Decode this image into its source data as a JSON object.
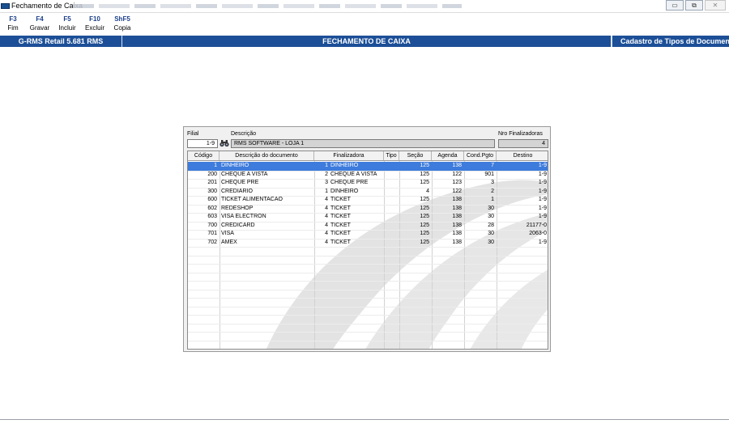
{
  "window": {
    "title": "Fechamento de Caixa",
    "controls": {
      "minimize": "▭",
      "restore": "⧉",
      "close": "✕"
    }
  },
  "toolbar": {
    "keys": [
      {
        "key": "F3",
        "label": "Fim"
      },
      {
        "key": "F4",
        "label": "Gravar"
      },
      {
        "key": "F5",
        "label": "Incluir"
      },
      {
        "key": "F10",
        "label": "Excluir"
      },
      {
        "key": "ShF5",
        "label": "Copia"
      }
    ]
  },
  "header": {
    "app_version": "G-RMS Retail 5.681 RMS",
    "screen_title": "FECHAMENTO DE CAIXA",
    "context": "Cadastro de Tipos de Documentos"
  },
  "form": {
    "filial_label": "Filial",
    "filial_value": "1-9",
    "descricao_label": "Descrição",
    "descricao_value": "RMS SOFTWARE - LOJA 1",
    "nro_finalizadoras_label": "Nro Finalizadoras",
    "nro_finalizadoras_value": "4"
  },
  "table": {
    "columns": [
      "Código",
      "Descrição do documento",
      "Finalizadora",
      "Tipo",
      "Seção",
      "Agenda",
      "Cond.Pgto",
      "Destino"
    ],
    "selected_row": 0,
    "rows": [
      {
        "codigo": "1",
        "descricao": "DINHEIRO",
        "fin_num": "1",
        "fin_nome": "DINHEIRO",
        "tipo": "",
        "secao": "125",
        "agenda": "138",
        "cond": "7",
        "destino": "1-9"
      },
      {
        "codigo": "200",
        "descricao": "CHEQUE A VISTA",
        "fin_num": "2",
        "fin_nome": "CHEQUE A VISTA",
        "tipo": "",
        "secao": "125",
        "agenda": "122",
        "cond": "901",
        "destino": "1-9"
      },
      {
        "codigo": "201",
        "descricao": "CHEQUE PRE",
        "fin_num": "3",
        "fin_nome": "CHEQUE PRE",
        "tipo": "",
        "secao": "125",
        "agenda": "123",
        "cond": "3",
        "destino": "1-9"
      },
      {
        "codigo": "300",
        "descricao": "CREDIARIO",
        "fin_num": "1",
        "fin_nome": "DINHEIRO",
        "tipo": "",
        "secao": "4",
        "agenda": "122",
        "cond": "2",
        "destino": "1-9"
      },
      {
        "codigo": "600",
        "descricao": "TICKET ALIMENTACAO",
        "fin_num": "4",
        "fin_nome": "TICKET",
        "tipo": "",
        "secao": "125",
        "agenda": "138",
        "cond": "1",
        "destino": "1-9"
      },
      {
        "codigo": "602",
        "descricao": "REDESHOP",
        "fin_num": "4",
        "fin_nome": "TICKET",
        "tipo": "",
        "secao": "125",
        "agenda": "138",
        "cond": "30",
        "destino": "1-9"
      },
      {
        "codigo": "603",
        "descricao": "VISA ELECTRON",
        "fin_num": "4",
        "fin_nome": "TICKET",
        "tipo": "",
        "secao": "125",
        "agenda": "138",
        "cond": "30",
        "destino": "1-9"
      },
      {
        "codigo": "700",
        "descricao": "CREDICARD",
        "fin_num": "4",
        "fin_nome": "TICKET",
        "tipo": "",
        "secao": "125",
        "agenda": "138",
        "cond": "28",
        "destino": "21177-0"
      },
      {
        "codigo": "701",
        "descricao": "VISA",
        "fin_num": "4",
        "fin_nome": "TICKET",
        "tipo": "",
        "secao": "125",
        "agenda": "138",
        "cond": "30",
        "destino": "2063-0"
      },
      {
        "codigo": "702",
        "descricao": "AMEX",
        "fin_num": "4",
        "fin_nome": "TICKET",
        "tipo": "",
        "secao": "125",
        "agenda": "138",
        "cond": "30",
        "destino": "1-9"
      }
    ]
  },
  "colors": {
    "header_bar": "#1c4f97",
    "selection": "#3d7bdc",
    "panel_bg": "#f0f0f0"
  }
}
